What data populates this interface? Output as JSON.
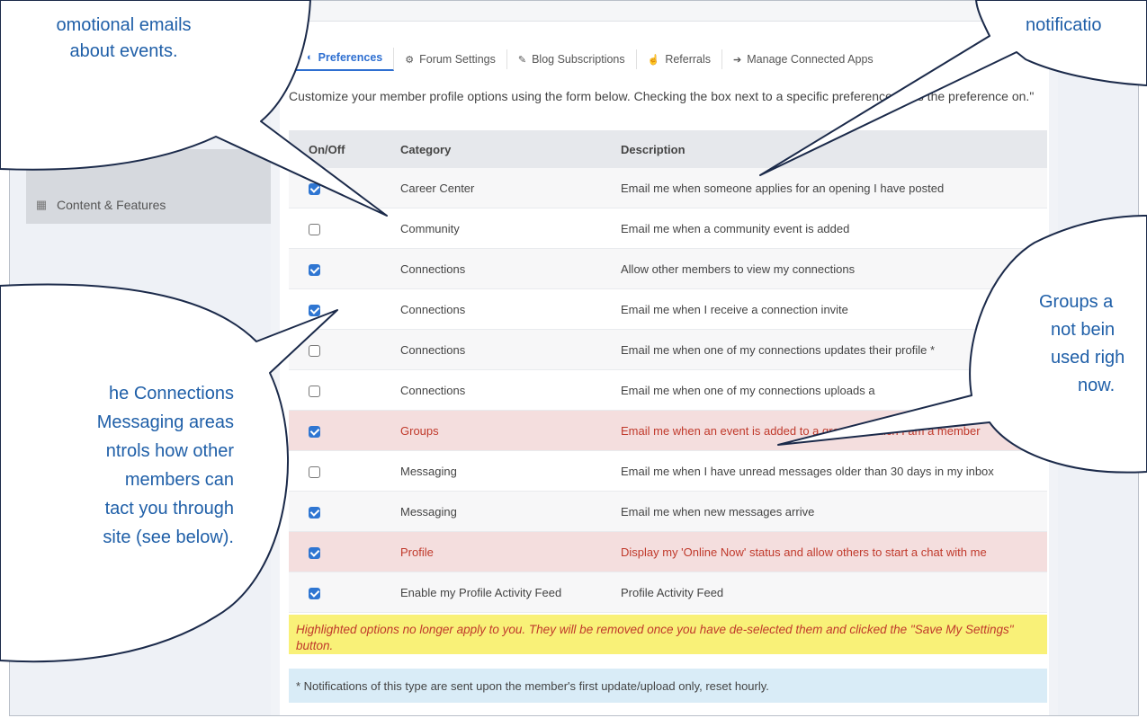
{
  "sidebar": {
    "items": [
      {
        "label": "Content & Features",
        "icon": "grid-icon"
      }
    ]
  },
  "tabs": [
    {
      "label": "Preferences",
      "icon": "toggle-icon",
      "active": true
    },
    {
      "label": "Forum Settings",
      "icon": "gears-icon",
      "active": false
    },
    {
      "label": "Blog Subscriptions",
      "icon": "edit-icon",
      "active": false
    },
    {
      "label": "Referrals",
      "icon": "thumbs-up-icon",
      "active": false
    },
    {
      "label": "Manage Connected Apps",
      "icon": "sign-in-icon",
      "active": false
    }
  ],
  "intro_text": "Customize your member profile options using the form below. Checking the box next to a specific preference turns the preference on.\"",
  "table": {
    "headers": [
      "On/Off",
      "Category",
      "Description"
    ],
    "rows": [
      {
        "checked": true,
        "category": "Career Center",
        "description": "Email me when someone applies for an opening I have posted",
        "highlight": false
      },
      {
        "checked": false,
        "category": "Community",
        "description": "Email me when a community event is added",
        "highlight": false
      },
      {
        "checked": true,
        "category": "Connections",
        "description": "Allow other members to view my connections",
        "highlight": false
      },
      {
        "checked": true,
        "category": "Connections",
        "description": "Email me when I receive a connection invite",
        "highlight": false
      },
      {
        "checked": false,
        "category": "Connections",
        "description": "Email me when one of my connections updates their profile *",
        "highlight": false
      },
      {
        "checked": false,
        "category": "Connections",
        "description": "Email me when one of my connections uploads a",
        "highlight": false
      },
      {
        "checked": true,
        "category": "Groups",
        "description": "Email me when an event is added to a group of which I am a member",
        "highlight": true
      },
      {
        "checked": false,
        "category": "Messaging",
        "description": "Email me when I have unread messages older than 30 days in my inbox",
        "highlight": false
      },
      {
        "checked": true,
        "category": "Messaging",
        "description": "Email me when new messages arrive",
        "highlight": false
      },
      {
        "checked": true,
        "category": "Profile",
        "description": "Display my 'Online Now' status and allow others to start a chat with me",
        "highlight": true
      },
      {
        "checked": true,
        "category": "Enable my Profile Activity Feed",
        "description": "Profile Activity Feed",
        "highlight": false
      }
    ]
  },
  "notes": {
    "highlight_note": "Highlighted options no longer apply to you. They will be removed once you have de-selected them and clicked the \"Save My Settings\" button.",
    "asterisk_note": "* Notifications of this type are sent upon the member's first update/upload only, reset hourly."
  },
  "callouts": {
    "promo": [
      "omotional emails",
      "about events."
    ],
    "notification": [
      "notificatio"
    ],
    "connections": [
      "he Connections",
      "Messaging areas",
      "ntrols how other",
      "members can",
      "tact you through",
      "site (see below)."
    ],
    "groups": [
      "Groups a",
      "not bein",
      "used righ",
      "now."
    ]
  },
  "colors": {
    "accent": "#2e6fd1",
    "callout_text": "#1f5fa8",
    "highlight_row": "#f4dede",
    "highlight_text": "#c0392b",
    "note_yellow": "#f9f178",
    "note_blue": "#d9ecf7"
  }
}
